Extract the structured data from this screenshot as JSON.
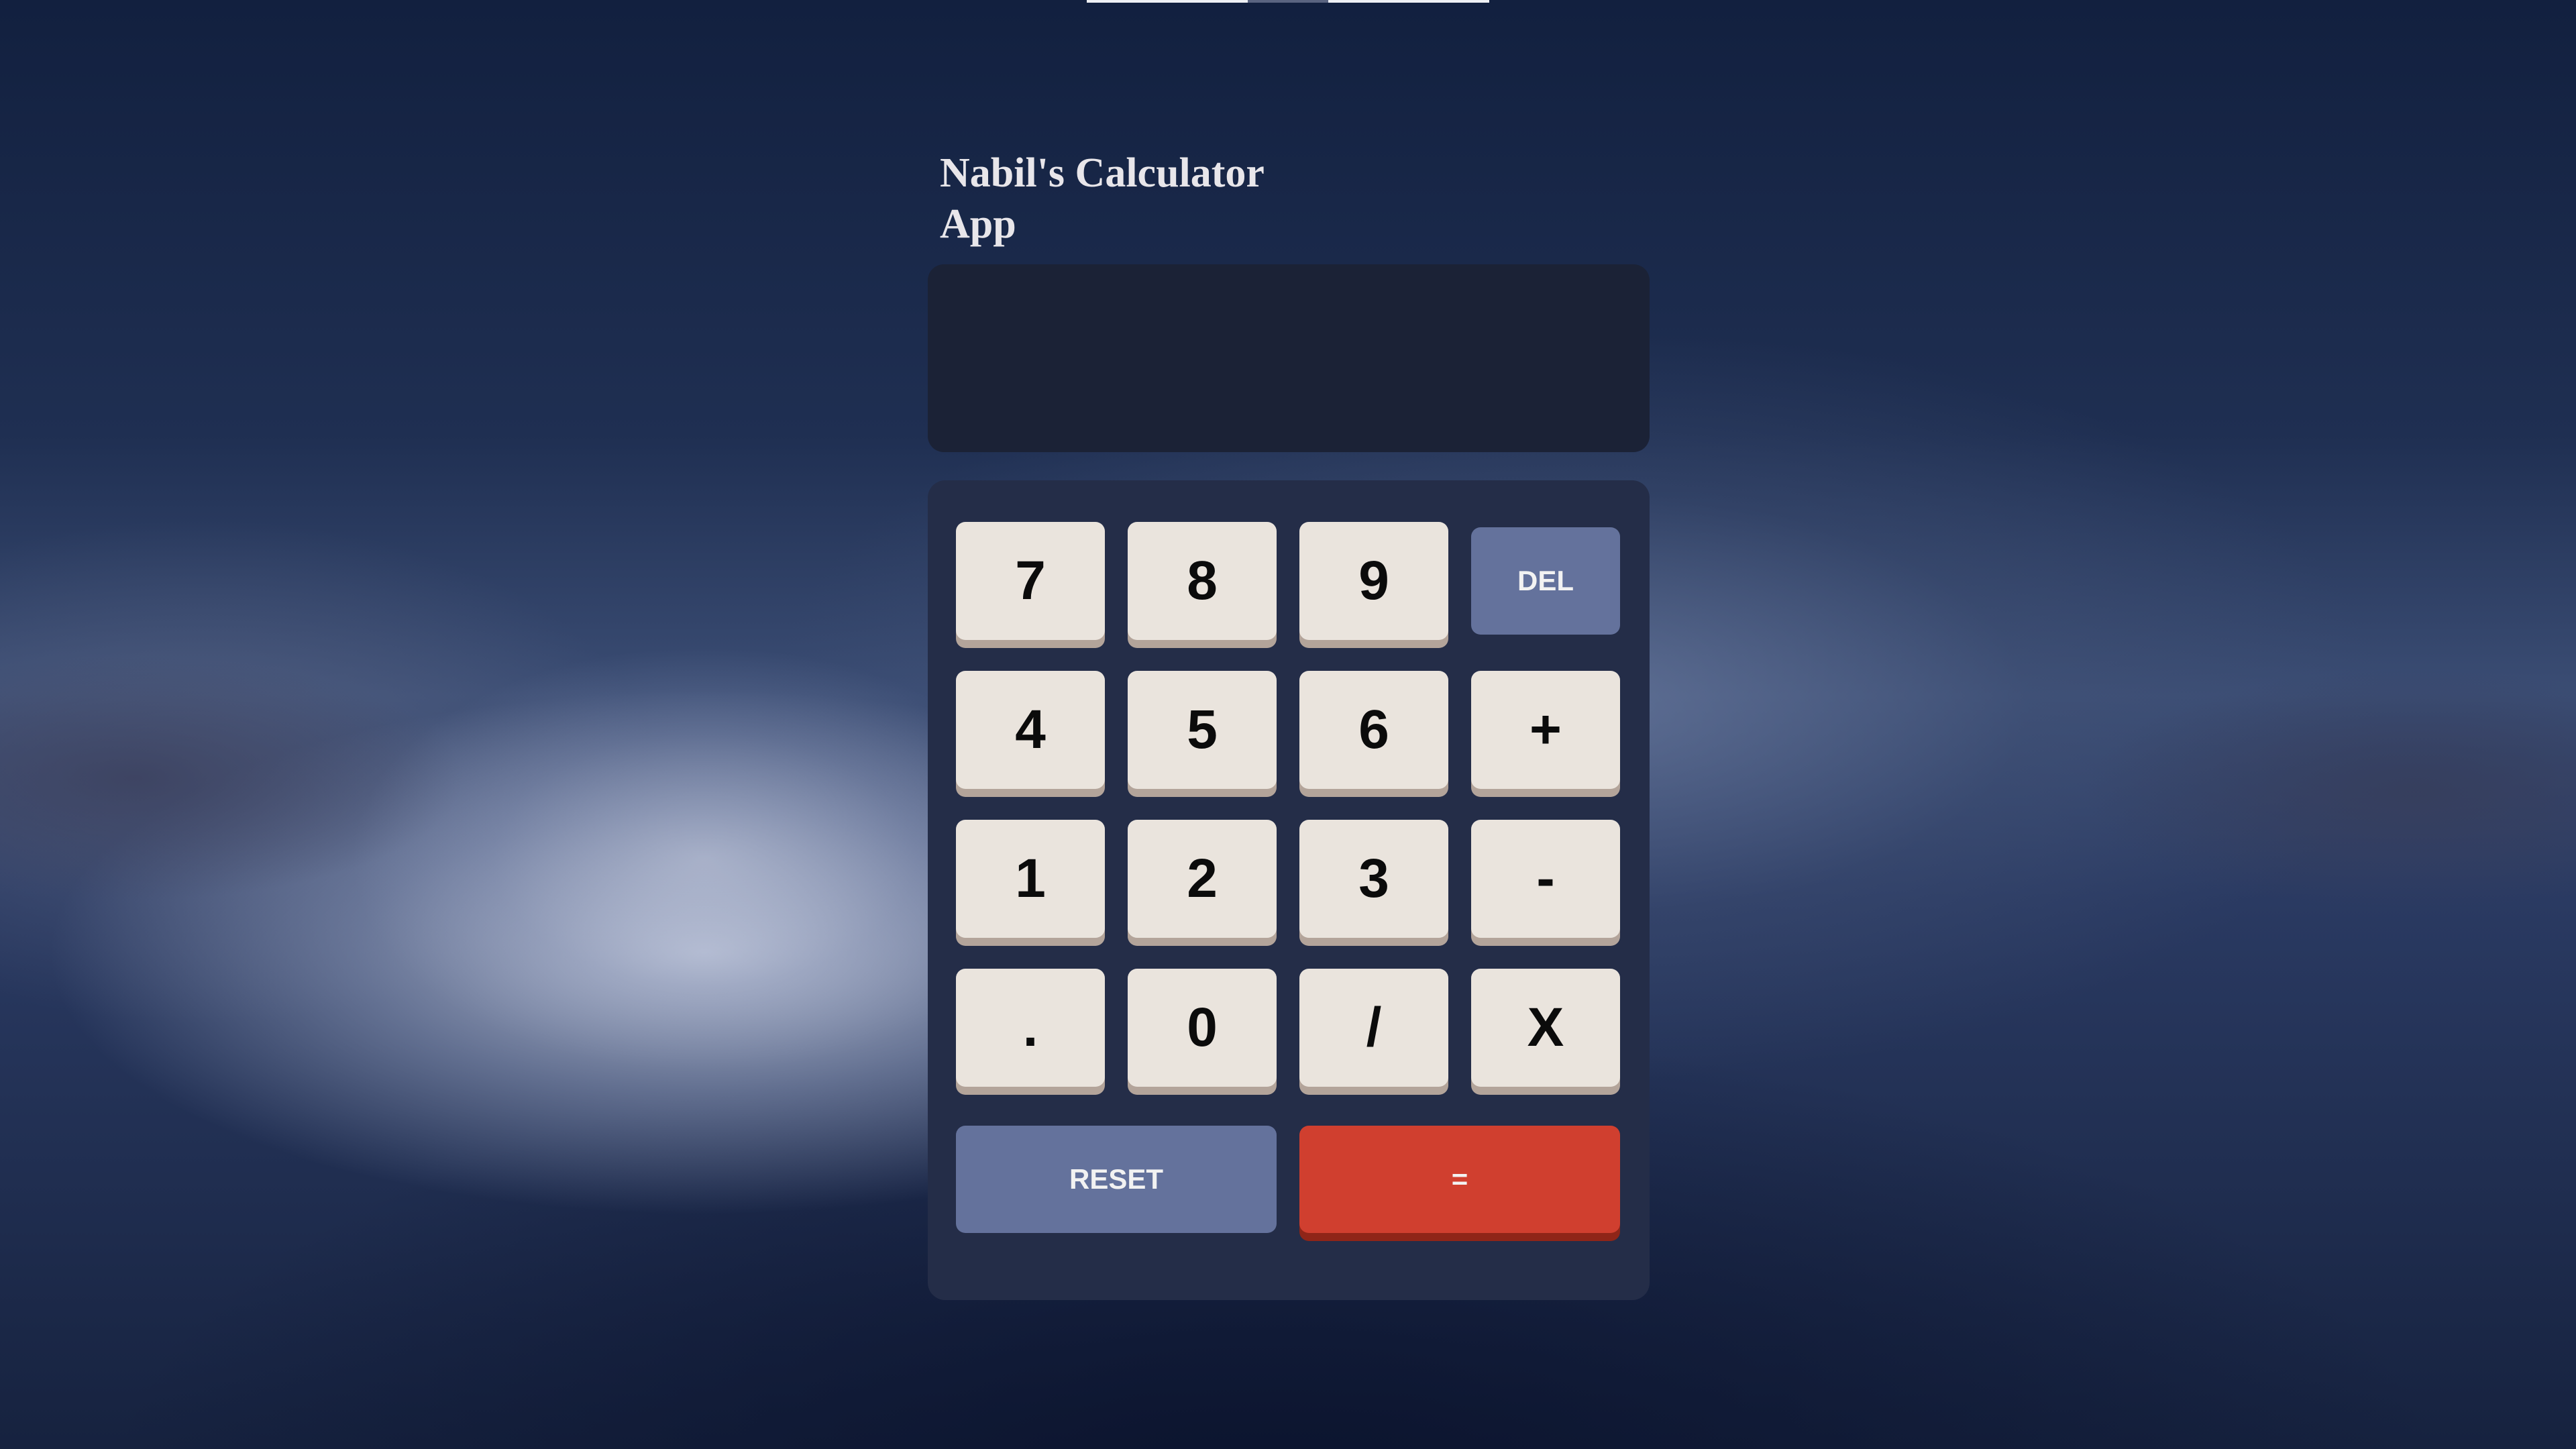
{
  "app": {
    "title": "Nabil's Calculator App"
  },
  "display": {
    "value": ""
  },
  "keypad": {
    "keys": [
      {
        "label": "7"
      },
      {
        "label": "8"
      },
      {
        "label": "9"
      },
      {
        "label": "DEL"
      },
      {
        "label": "4"
      },
      {
        "label": "5"
      },
      {
        "label": "6"
      },
      {
        "label": "+"
      },
      {
        "label": "1"
      },
      {
        "label": "2"
      },
      {
        "label": "3"
      },
      {
        "label": "-"
      },
      {
        "label": "."
      },
      {
        "label": "0"
      },
      {
        "label": "/"
      },
      {
        "label": "X"
      }
    ],
    "reset_label": "RESET",
    "equals_label": "="
  },
  "colors": {
    "display_bg": "#1b2236",
    "keypad_bg": "#242d48",
    "key_bg": "#eae4dd",
    "key_shadow": "#b3a49a",
    "function_key_bg": "#64729c",
    "equals_key_bg": "#d03f2f",
    "equals_key_shadow": "#8f2518",
    "title_text": "#e8e6ea"
  }
}
